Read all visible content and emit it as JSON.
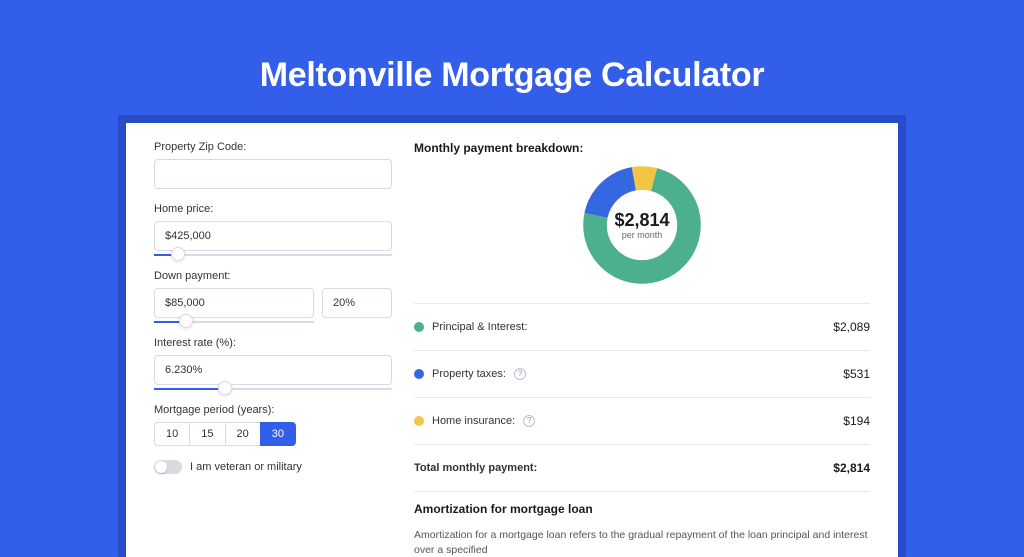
{
  "title": "Meltonville Mortgage Calculator",
  "colors": {
    "primary": "#335eea",
    "green": "#4caf8e",
    "blue": "#3567e0",
    "yellow": "#f4c445"
  },
  "left": {
    "zip_label": "Property Zip Code:",
    "zip_value": "",
    "home_price_label": "Home price:",
    "home_price_value": "$425,000",
    "home_price_slider_pct": 10,
    "down_label": "Down payment:",
    "down_amount": "$85,000",
    "down_pct": "20%",
    "down_slider_pct": 20,
    "rate_label": "Interest rate (%):",
    "rate_value": "6.230%",
    "rate_slider_pct": 30,
    "period_label": "Mortgage period (years):",
    "period_options": [
      "10",
      "15",
      "20",
      "30"
    ],
    "period_active": "30",
    "veteran_label": "I am veteran or military",
    "veteran_value": false
  },
  "breakdown": {
    "title": "Monthly payment breakdown:",
    "center_amount": "$2,814",
    "center_sub": "per month",
    "rows": [
      {
        "label": "Principal & Interest:",
        "value": "$2,089",
        "color": "#4caf8e",
        "info": false
      },
      {
        "label": "Property taxes:",
        "value": "$531",
        "color": "#3567e0",
        "info": true
      },
      {
        "label": "Home insurance:",
        "value": "$194",
        "color": "#f4c445",
        "info": true
      }
    ],
    "total_label": "Total monthly payment:",
    "total_value": "$2,814"
  },
  "chart_data": {
    "type": "pie",
    "title": "Monthly payment breakdown",
    "series": [
      {
        "name": "Principal & Interest",
        "value": 2089,
        "color": "#4caf8e"
      },
      {
        "name": "Property taxes",
        "value": 531,
        "color": "#3567e0"
      },
      {
        "name": "Home insurance",
        "value": 194,
        "color": "#f4c445"
      }
    ],
    "total": 2814,
    "center_label": "$2,814 per month"
  },
  "amortization": {
    "title": "Amortization for mortgage loan",
    "desc": "Amortization for a mortgage loan refers to the gradual repayment of the loan principal and interest over a specified"
  }
}
